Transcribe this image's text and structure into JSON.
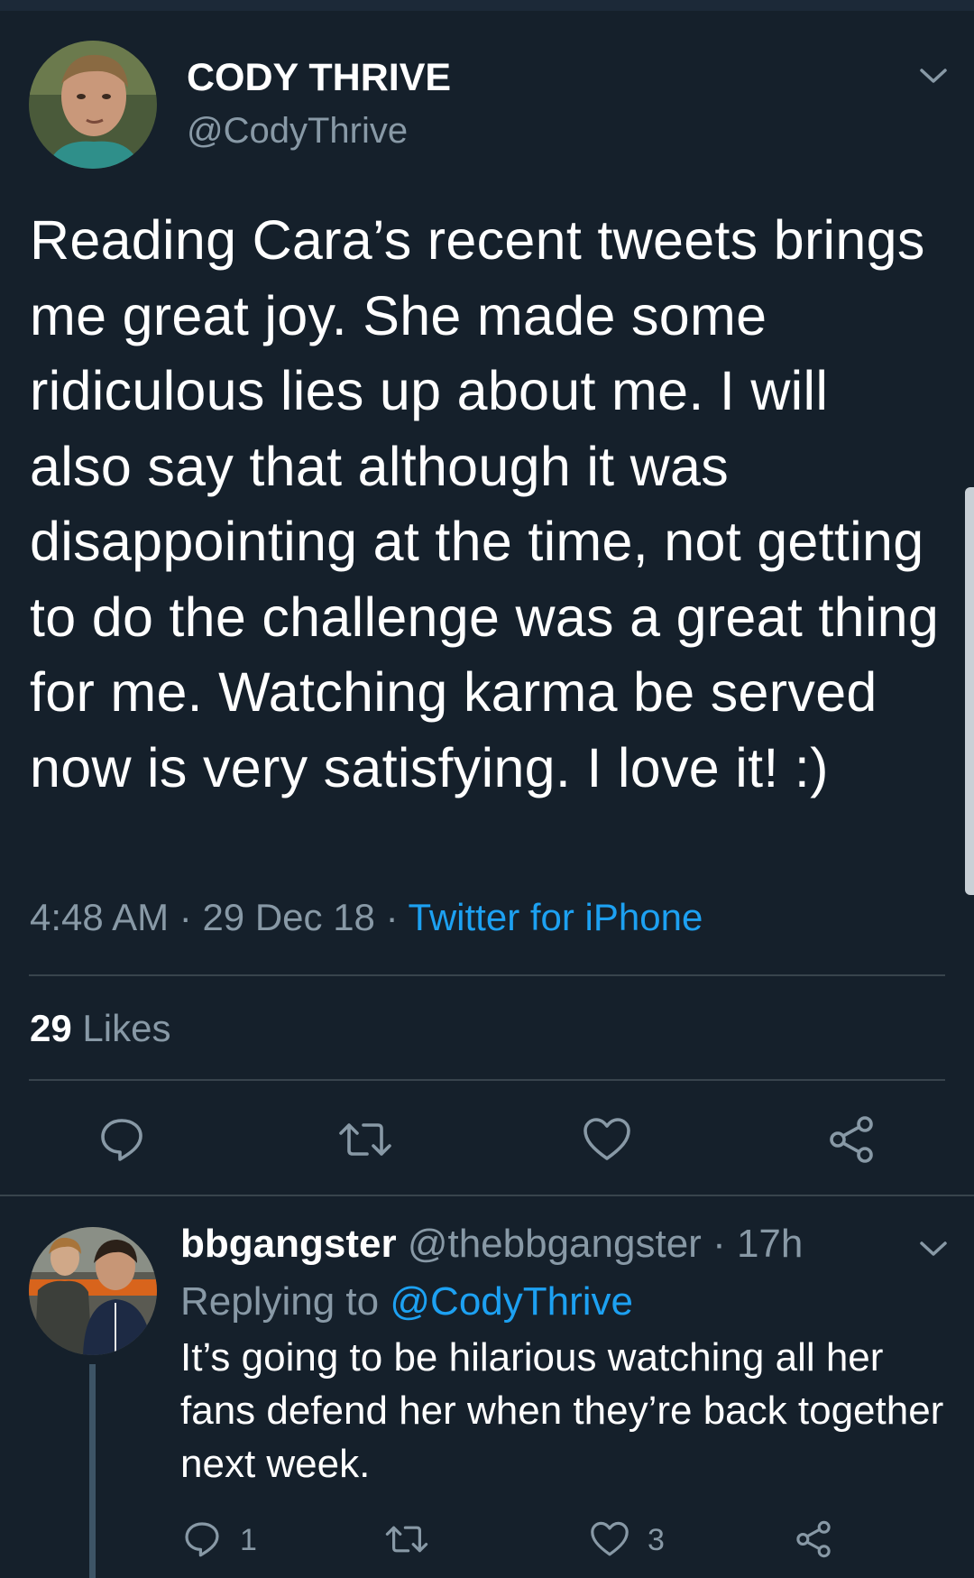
{
  "tweet": {
    "display_name": "CODY THRIVE",
    "handle": "@CodyThrive",
    "text": "Reading Cara’s recent tweets brings me great joy. She made some ridiculous lies up about me. I will also say that although it was disappointing at the time, not getting to do the challenge was a great thing for me. Watching karma be served now is very satisfying. I love it! :)",
    "time": "4:48 AM",
    "date": "29 Dec 18",
    "separator": "·",
    "source": "Twitter for iPhone",
    "likes_count": "29",
    "likes_label": "Likes"
  },
  "reply": {
    "name": "bbgangster",
    "handle": "@thebbgangster",
    "separator": "·",
    "age": "17h",
    "replying_prefix": "Replying to",
    "replying_to": "@CodyThrive",
    "text": "It’s going to be hilarious watching all her fans defend her when they’re back together next week.",
    "reply_count": "1",
    "like_count": "3"
  },
  "icons": {
    "more": "chevron-down-icon",
    "reply": "speech-bubble-icon",
    "retweet": "retweet-icon",
    "like": "heart-icon",
    "share": "share-icon"
  },
  "colors": {
    "background": "#15202b",
    "accent": "#1da1f2",
    "secondary_text": "#8899a6",
    "divider": "#38444d"
  }
}
